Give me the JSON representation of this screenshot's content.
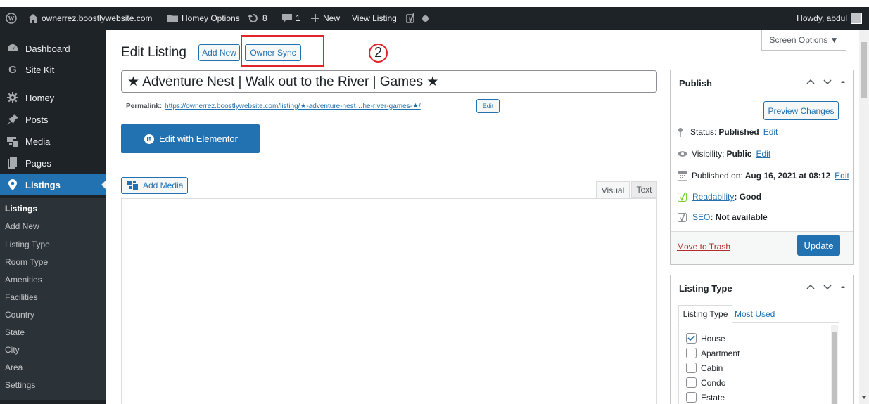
{
  "adminbar": {
    "site_name": "ownerrez.boostlywebsite.com",
    "homey_options": "Homey Options",
    "updates_count": "8",
    "comments_count": "1",
    "new_label": "New",
    "view_listing": "View Listing",
    "howdy": "Howdy, abdul"
  },
  "sidebar": {
    "items": [
      {
        "label": "Dashboard",
        "icon": "dashboard-icon"
      },
      {
        "label": "Site Kit",
        "icon": "google-g-icon"
      },
      {
        "label": "Homey",
        "icon": "gear-icon"
      },
      {
        "label": "Posts",
        "icon": "pushpin-icon"
      },
      {
        "label": "Media",
        "icon": "media-icon"
      },
      {
        "label": "Pages",
        "icon": "pages-icon"
      },
      {
        "label": "Listings",
        "icon": "location-pin-icon"
      }
    ],
    "submenu": [
      "Listings",
      "Add New",
      "Listing Type",
      "Room Type",
      "Amenities",
      "Facilities",
      "Country",
      "State",
      "City",
      "Area",
      "Settings"
    ]
  },
  "header": {
    "title": "Edit Listing",
    "add_new": "Add New",
    "owner_sync": "Owner Sync",
    "annotation": "2",
    "screen_options": "Screen Options ▼"
  },
  "editor": {
    "post_title": "★ Adventure Nest | Walk out to the River | Games ★",
    "permalink_label": "Permalink:",
    "permalink_url": "https://ownerrez.boostlywebsite.com/listing/★-adventure-nest…he-river-games-★/",
    "permalink_edit": "Edit",
    "elementor_button": "Edit with Elementor",
    "add_media": "Add Media",
    "tab_visual": "Visual",
    "tab_text": "Text"
  },
  "publish": {
    "title": "Publish",
    "preview": "Preview Changes",
    "status_label": "Status:",
    "status_value": "Published",
    "status_edit": "Edit",
    "visibility_label": "Visibility:",
    "visibility_value": "Public",
    "visibility_edit": "Edit",
    "published_label": "Published on:",
    "published_value": "Aug 16, 2021 at 08:12",
    "published_edit": "Edit",
    "readability_label": "Readability",
    "readability_value": ": Good",
    "seo_label": "SEO",
    "seo_value": ": Not available",
    "trash": "Move to Trash",
    "update": "Update"
  },
  "listing_type": {
    "title": "Listing Type",
    "tab_all": "Listing Type",
    "tab_used": "Most Used",
    "options": [
      {
        "label": "House",
        "checked": true
      },
      {
        "label": "Apartment",
        "checked": false
      },
      {
        "label": "Cabin",
        "checked": false
      },
      {
        "label": "Condo",
        "checked": false
      },
      {
        "label": "Estate",
        "checked": false
      }
    ]
  },
  "colors": {
    "admin_dark": "#1d2327",
    "accent_blue": "#2271b1",
    "highlight_red": "#e0242a",
    "trash_red": "#b32d2e"
  }
}
